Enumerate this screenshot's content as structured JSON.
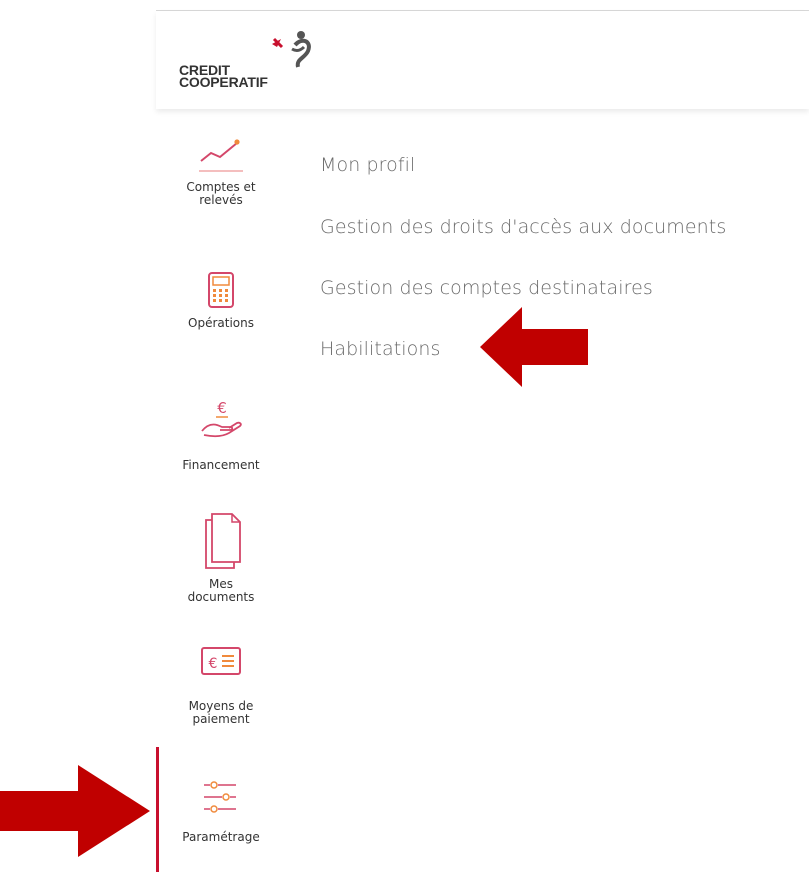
{
  "brand": {
    "line1": "CREDIT",
    "line2": "COOPERATIF"
  },
  "sidebar": {
    "items": [
      {
        "icon": "chart-line-icon",
        "label_lines": [
          "Comptes et",
          "relevés"
        ]
      },
      {
        "icon": "calculator-icon",
        "label_lines": [
          "Opérations"
        ]
      },
      {
        "icon": "hand-euro-icon",
        "label_lines": [
          "Financement"
        ]
      },
      {
        "icon": "documents-icon",
        "label_lines": [
          "Mes",
          "documents"
        ]
      },
      {
        "icon": "euro-card-icon",
        "label_lines": [
          "Moyens de",
          "paiement"
        ]
      },
      {
        "icon": "sliders-icon",
        "label_lines": [
          "Paramétrage"
        ],
        "active": true
      }
    ]
  },
  "menu": {
    "items": [
      "Mon profil",
      "Gestion des droits d'accès aux documents",
      "Gestion des comptes destinataires",
      "Habilitations"
    ]
  },
  "colors": {
    "accent": "#c8102e",
    "icon_pink": "#d4476a",
    "icon_orange": "#f08a3c",
    "arrow": "#c00000"
  }
}
